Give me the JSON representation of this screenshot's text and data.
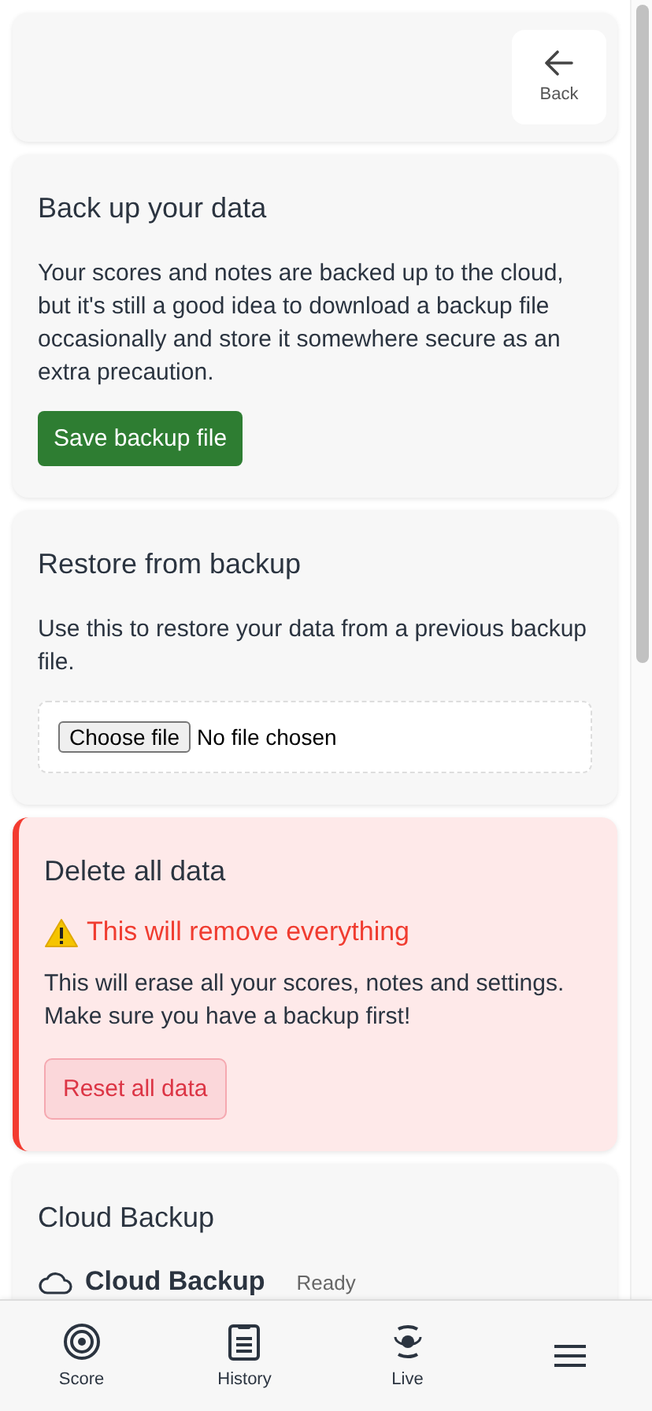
{
  "header": {
    "back_button": {
      "label": "Back"
    }
  },
  "sections": [
    {
      "kind": "backup",
      "title": "Back up your data",
      "text": "Your scores and notes are backed up to the cloud, but it's still a good idea to download a backup file occasionally and store it somewhere secure as an extra precaution.",
      "button": "Save backup file"
    },
    {
      "kind": "restore",
      "title": "Restore from backup",
      "text": "Use this to restore your data from a previous backup file.",
      "file_button": "Choose file",
      "file_status": "No file chosen"
    },
    {
      "kind": "danger",
      "title": "Delete all data",
      "warning": "This will remove everything",
      "text": "This will erase all your scores, notes and settings. Make sure you have a backup first!",
      "button": "Reset all data"
    },
    {
      "kind": "cloud",
      "title": "Cloud Backup",
      "service": "Cloud Backup",
      "status": "Ready"
    }
  ],
  "bottom_nav": [
    {
      "kind": "score",
      "label": "Score"
    },
    {
      "kind": "history",
      "label": "History"
    },
    {
      "kind": "live",
      "label": "Live"
    },
    {
      "kind": "menu"
    }
  ]
}
